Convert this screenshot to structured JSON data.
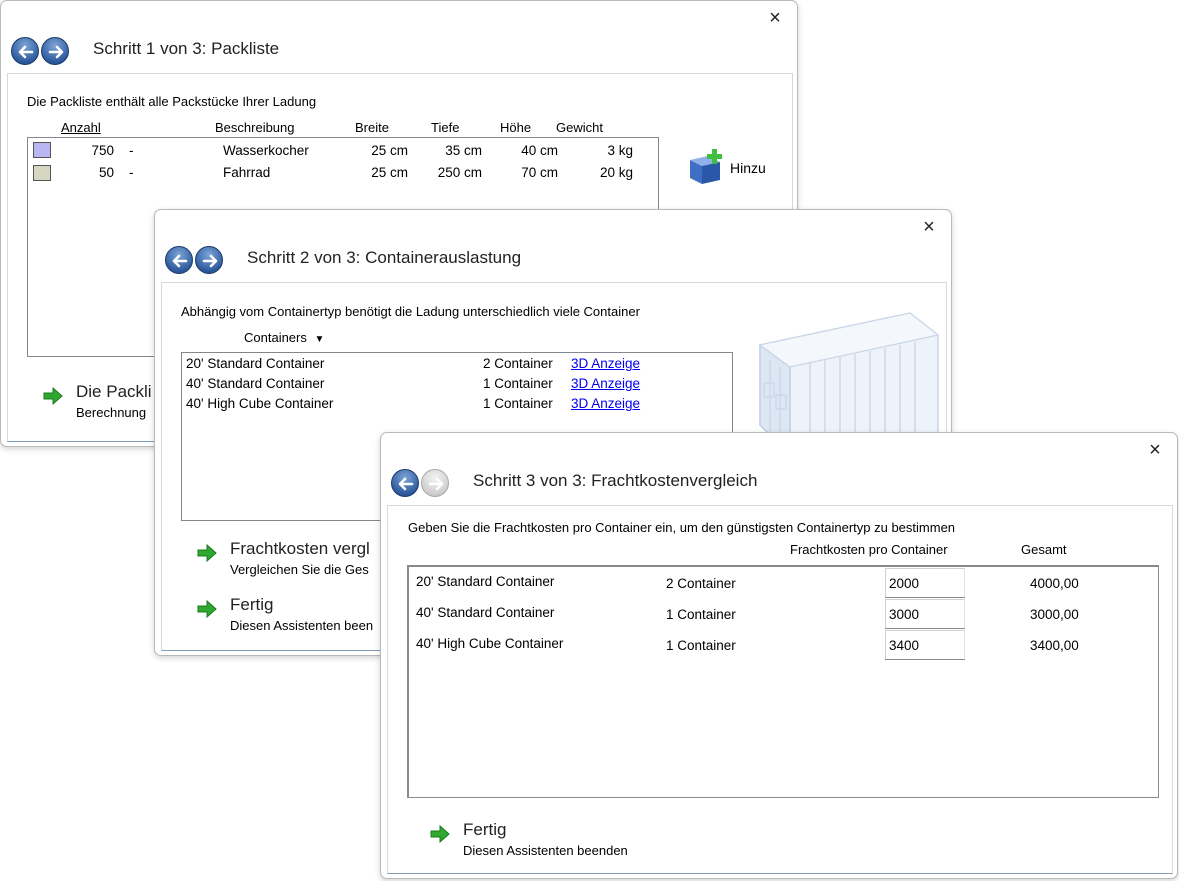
{
  "colors": {
    "accent": "#2e5c9e",
    "link": "#0000ee",
    "arrow_green": "#2ea82e"
  },
  "window1": {
    "title": "Schritt 1 von 3: Packliste",
    "hint": "Die Packliste enthält alle Packstücke Ihrer Ladung",
    "columns": [
      "Anzahl",
      "Beschreibung",
      "Breite",
      "Tiefe",
      "Höhe",
      "Gewicht"
    ],
    "rows": [
      {
        "color": "#b9b6f2",
        "count": "750",
        "dash": "-",
        "desc": "Wasserkocher",
        "width": "25 cm",
        "depth": "35 cm",
        "height": "40 cm",
        "weight": "3 kg"
      },
      {
        "color": "#d6d7c1",
        "count": "50",
        "dash": "-",
        "desc": "Fahrrad",
        "width": "25 cm",
        "depth": "250 cm",
        "height": "70 cm",
        "weight": "20 kg"
      }
    ],
    "add_label": "Hinzu",
    "next_title": "Die Packli",
    "next_sub": "Berechnung"
  },
  "window2": {
    "title": "Schritt 2 von 3: Containerauslastung",
    "hint": "Abhängig vom Containertyp benötigt die Ladung unterschiedlich viele Container",
    "dropdown_label": "Containers",
    "rows": [
      {
        "name": "20' Standard Container",
        "count": "2 Container",
        "link": "3D Anzeige"
      },
      {
        "name": "40' Standard Container",
        "count": "1 Container",
        "link": "3D Anzeige"
      },
      {
        "name": "40' High Cube Container",
        "count": "1 Container",
        "link": "3D Anzeige"
      }
    ],
    "cmd1_title": "Frachtkosten vergl",
    "cmd1_sub": "Vergleichen Sie die Ges",
    "cmd2_title": "Fertig",
    "cmd2_sub": "Diesen Assistenten been"
  },
  "window3": {
    "title": "Schritt 3 von 3: Frachtkostenvergleich",
    "hint": "Geben Sie die Frachtkosten pro Container ein, um den günstigsten Containertyp zu bestimmen",
    "col_cost": "Frachtkosten pro Container",
    "col_total": "Gesamt",
    "rows": [
      {
        "name": "20' Standard Container",
        "count": "2 Container",
        "cost": "2000",
        "total": "4000,00"
      },
      {
        "name": "40' Standard Container",
        "count": "1 Container",
        "cost": "3000",
        "total": "3000,00"
      },
      {
        "name": "40' High Cube Container",
        "count": "1 Container",
        "cost": "3400",
        "total": "3400,00"
      }
    ],
    "finish_title": "Fertig",
    "finish_sub": "Diesen Assistenten beenden"
  },
  "icons": {
    "close": "×",
    "back": "back-arrow-icon",
    "forward": "forward-arrow-icon",
    "dropdown": "▼",
    "command_arrow": "green-arrow-icon",
    "add": "add-package-icon",
    "container": "container-image"
  }
}
